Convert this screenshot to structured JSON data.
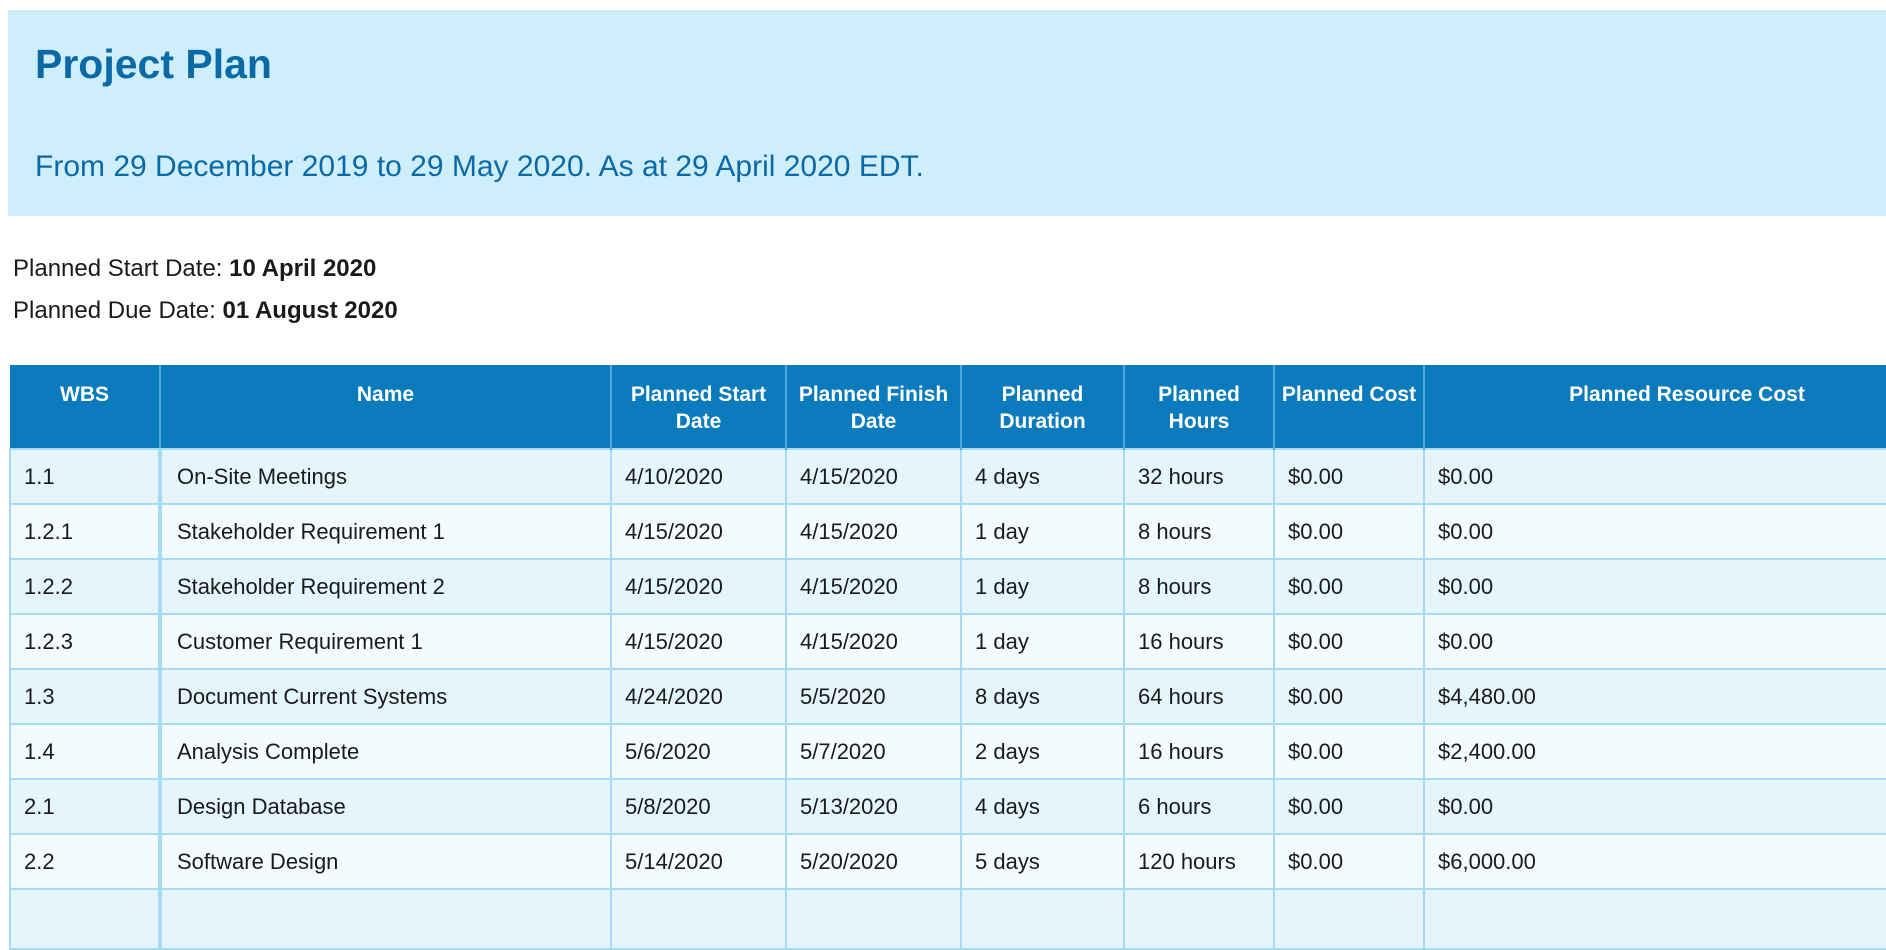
{
  "header": {
    "title": "Project Plan",
    "subtitle": "From 29 December 2019 to 29 May 2020. As at 29 April 2020 EDT."
  },
  "summary": {
    "start_label": "Planned Start Date:",
    "start_value": "10 April 2020",
    "due_label": "Planned Due Date:",
    "due_value": "01 August 2020"
  },
  "table": {
    "columns": [
      "WBS",
      "Name",
      "Planned Start Date",
      "Planned Finish Date",
      "Planned Duration",
      "Planned Hours",
      "Planned Cost",
      "Planned Resource Cost"
    ],
    "rows": [
      [
        "1.1",
        "On-Site Meetings",
        "4/10/2020",
        "4/15/2020",
        "4 days",
        "32 hours",
        "$0.00",
        "$0.00"
      ],
      [
        "1.2.1",
        "Stakeholder Requirement 1",
        "4/15/2020",
        "4/15/2020",
        "1 day",
        "8 hours",
        "$0.00",
        "$0.00"
      ],
      [
        "1.2.2",
        "Stakeholder Requirement 2",
        "4/15/2020",
        "4/15/2020",
        "1 day",
        "8 hours",
        "$0.00",
        "$0.00"
      ],
      [
        "1.2.3",
        "Customer Requirement 1",
        "4/15/2020",
        "4/15/2020",
        "1 day",
        "16 hours",
        "$0.00",
        "$0.00"
      ],
      [
        "1.3",
        "Document Current Systems",
        "4/24/2020",
        "5/5/2020",
        "8 days",
        "64 hours",
        "$0.00",
        "$4,480.00"
      ],
      [
        "1.4",
        "Analysis Complete",
        "5/6/2020",
        "5/7/2020",
        "2 days",
        "16 hours",
        "$0.00",
        "$2,400.00"
      ],
      [
        "2.1",
        "Design Database",
        "5/8/2020",
        "5/13/2020",
        "4 days",
        "6 hours",
        "$0.00",
        "$0.00"
      ],
      [
        "2.2",
        "Software Design",
        "5/14/2020",
        "5/20/2020",
        "5 days",
        "120 hours",
        "$0.00",
        "$6,000.00"
      ],
      [
        "",
        "",
        "",
        "",
        "",
        "",
        "",
        ""
      ]
    ]
  }
}
